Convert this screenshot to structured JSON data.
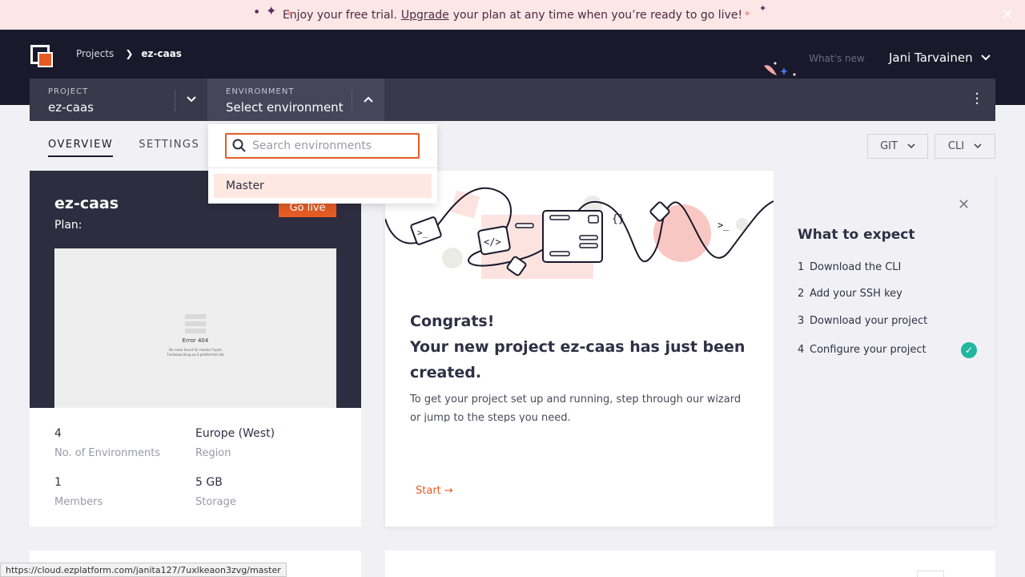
{
  "banner": {
    "text_before": "Enjoy your free trial.",
    "link": "Upgrade",
    "text_after": "your plan at any time when you’re ready to go live!"
  },
  "header": {
    "breadcrumb": {
      "root": "Projects",
      "current": "ez-caas"
    },
    "whats_new": "What's new",
    "user_name": "Jani Tarvainen"
  },
  "selector": {
    "project": {
      "label": "PROJECT",
      "value": "ez-caas"
    },
    "environment": {
      "label": "ENVIRONMENT",
      "value": "Select environment"
    }
  },
  "tabs": [
    {
      "label": "OVERVIEW",
      "active": true
    },
    {
      "label": "SETTINGS",
      "active": false
    }
  ],
  "toolbar": {
    "git_label": "GIT",
    "cli_label": "CLI"
  },
  "dropdown": {
    "search_placeholder": "Search environments",
    "options": [
      "Master"
    ]
  },
  "project_card": {
    "name": "ez-caas",
    "plan_label": "Plan:",
    "go_live": "Go live",
    "preview": {
      "error_title": "Error 404",
      "error_line1": "No route found for master.7xpsls",
      "error_line2": "7uxlkeaon3zvg.eu-4.platformsh.site"
    },
    "stats": [
      {
        "value": "4",
        "label": "No. of Environments"
      },
      {
        "value": "Europe (West)",
        "label": "Region"
      },
      {
        "value": "1",
        "label": "Members"
      },
      {
        "value": "5 GB",
        "label": "Storage"
      }
    ]
  },
  "congrats": {
    "line1": "Congrats!",
    "line2": "Your new project ez-caas has just been created.",
    "description": "To get your project set up and running, step through our wizard or jump to the steps you need.",
    "start": "Start",
    "art_prompt": ">_",
    "art_code": "</>",
    "art_braces": "{}"
  },
  "expect": {
    "title": "What to expect",
    "steps": [
      {
        "num": "1",
        "label": "Download the CLI"
      },
      {
        "num": "2",
        "label": "Add your SSH key"
      },
      {
        "num": "3",
        "label": "Download your project"
      },
      {
        "num": "4",
        "label": "Configure your project",
        "done": true
      }
    ]
  },
  "status_url": "https://cloud.ezplatform.com/janita127/7uxlkeaon3zvg/master",
  "colors": {
    "accent": "#e45c24",
    "header_bg": "#1a192b",
    "selector_bg": "#38394a",
    "success": "#23b7a0",
    "banner_bg": "#fde6e6"
  }
}
